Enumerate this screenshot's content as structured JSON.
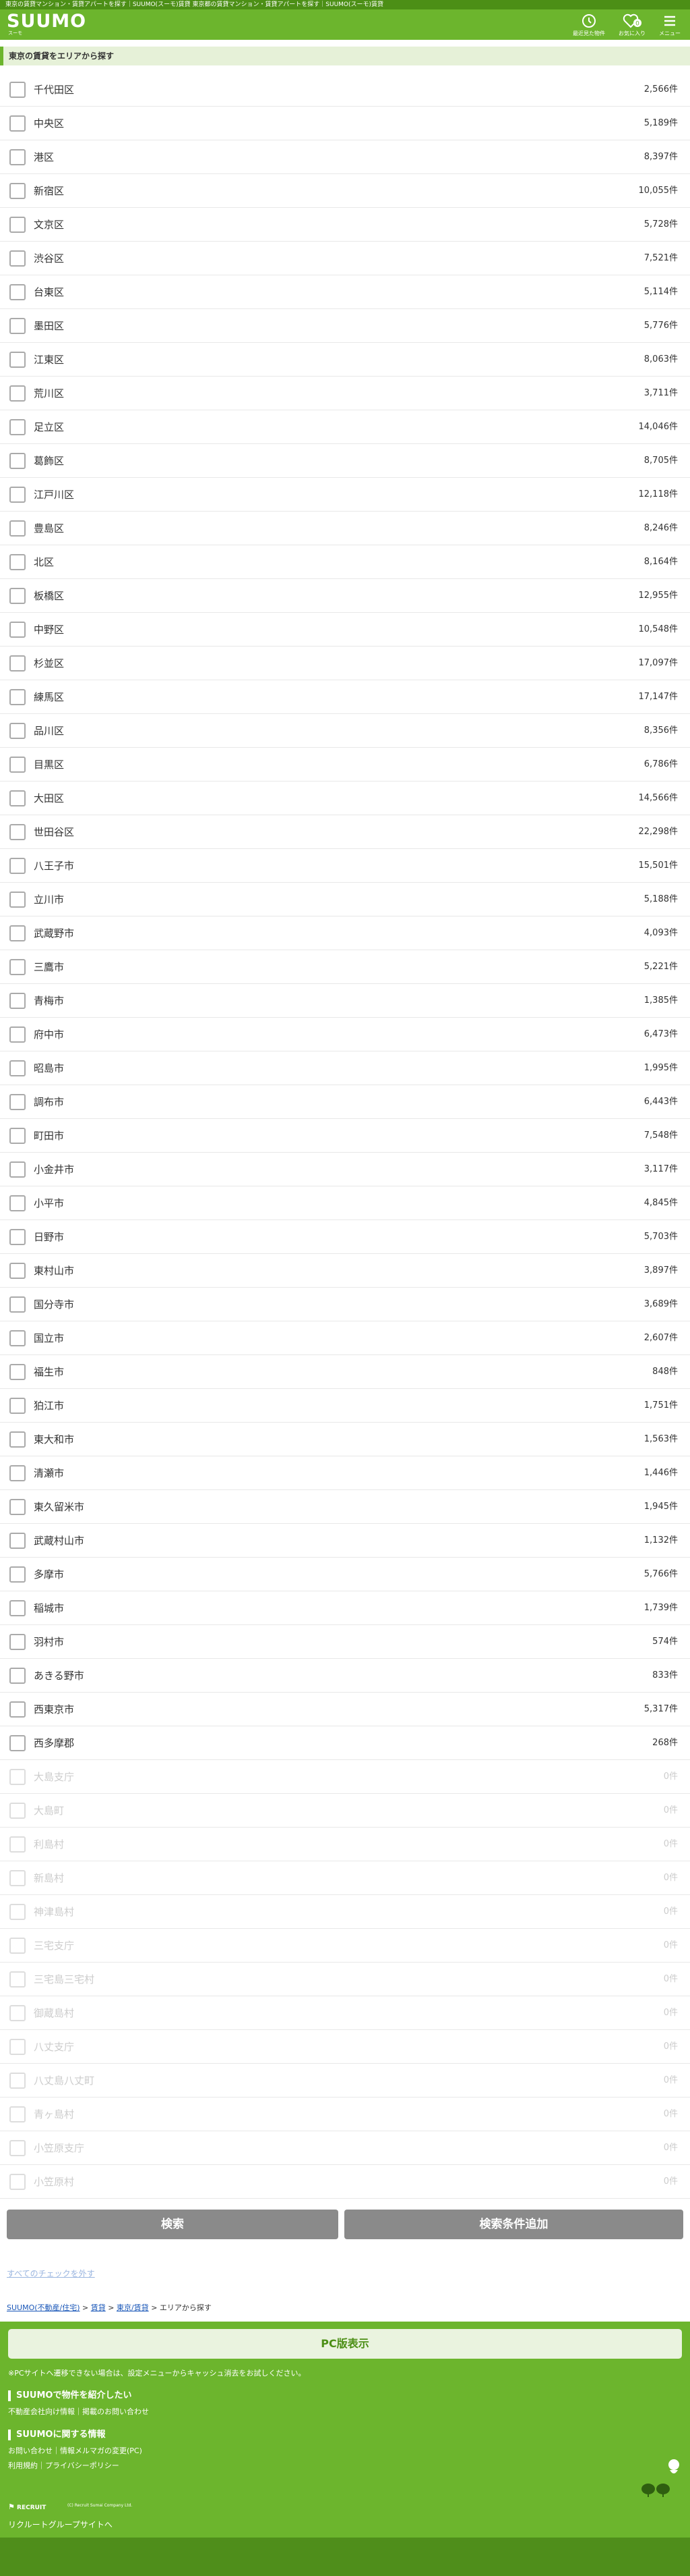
{
  "top_strip": "東京の賃貸マンション・賃貸アパートを探す｜SUUMO(スーモ)賃貸 東京都の賃貸マンション・賃貸アパートを探す｜SUUMO(スーモ)賃貸",
  "header": {
    "logo": "SUUMO",
    "logo_sub": "スーモ",
    "history_label": "最近見た物件",
    "favorites_label": "お気に入り",
    "favorites_count": "0",
    "menu_label": "メニュー"
  },
  "section_title": "東京の賃貸をエリアから探す",
  "areas": [
    {
      "name": "千代田区",
      "count": "2,566件",
      "enabled": true
    },
    {
      "name": "中央区",
      "count": "5,189件",
      "enabled": true
    },
    {
      "name": "港区",
      "count": "8,397件",
      "enabled": true
    },
    {
      "name": "新宿区",
      "count": "10,055件",
      "enabled": true
    },
    {
      "name": "文京区",
      "count": "5,728件",
      "enabled": true
    },
    {
      "name": "渋谷区",
      "count": "7,521件",
      "enabled": true
    },
    {
      "name": "台東区",
      "count": "5,114件",
      "enabled": true
    },
    {
      "name": "墨田区",
      "count": "5,776件",
      "enabled": true
    },
    {
      "name": "江東区",
      "count": "8,063件",
      "enabled": true
    },
    {
      "name": "荒川区",
      "count": "3,711件",
      "enabled": true
    },
    {
      "name": "足立区",
      "count": "14,046件",
      "enabled": true
    },
    {
      "name": "葛飾区",
      "count": "8,705件",
      "enabled": true
    },
    {
      "name": "江戸川区",
      "count": "12,118件",
      "enabled": true
    },
    {
      "name": "豊島区",
      "count": "8,246件",
      "enabled": true
    },
    {
      "name": "北区",
      "count": "8,164件",
      "enabled": true
    },
    {
      "name": "板橋区",
      "count": "12,955件",
      "enabled": true
    },
    {
      "name": "中野区",
      "count": "10,548件",
      "enabled": true
    },
    {
      "name": "杉並区",
      "count": "17,097件",
      "enabled": true
    },
    {
      "name": "練馬区",
      "count": "17,147件",
      "enabled": true
    },
    {
      "name": "品川区",
      "count": "8,356件",
      "enabled": true
    },
    {
      "name": "目黒区",
      "count": "6,786件",
      "enabled": true
    },
    {
      "name": "大田区",
      "count": "14,566件",
      "enabled": true
    },
    {
      "name": "世田谷区",
      "count": "22,298件",
      "enabled": true
    },
    {
      "name": "八王子市",
      "count": "15,501件",
      "enabled": true
    },
    {
      "name": "立川市",
      "count": "5,188件",
      "enabled": true
    },
    {
      "name": "武蔵野市",
      "count": "4,093件",
      "enabled": true
    },
    {
      "name": "三鷹市",
      "count": "5,221件",
      "enabled": true
    },
    {
      "name": "青梅市",
      "count": "1,385件",
      "enabled": true
    },
    {
      "name": "府中市",
      "count": "6,473件",
      "enabled": true
    },
    {
      "name": "昭島市",
      "count": "1,995件",
      "enabled": true
    },
    {
      "name": "調布市",
      "count": "6,443件",
      "enabled": true
    },
    {
      "name": "町田市",
      "count": "7,548件",
      "enabled": true
    },
    {
      "name": "小金井市",
      "count": "3,117件",
      "enabled": true
    },
    {
      "name": "小平市",
      "count": "4,845件",
      "enabled": true
    },
    {
      "name": "日野市",
      "count": "5,703件",
      "enabled": true
    },
    {
      "name": "東村山市",
      "count": "3,897件",
      "enabled": true
    },
    {
      "name": "国分寺市",
      "count": "3,689件",
      "enabled": true
    },
    {
      "name": "国立市",
      "count": "2,607件",
      "enabled": true
    },
    {
      "name": "福生市",
      "count": "848件",
      "enabled": true
    },
    {
      "name": "狛江市",
      "count": "1,751件",
      "enabled": true
    },
    {
      "name": "東大和市",
      "count": "1,563件",
      "enabled": true
    },
    {
      "name": "清瀬市",
      "count": "1,446件",
      "enabled": true
    },
    {
      "name": "東久留米市",
      "count": "1,945件",
      "enabled": true
    },
    {
      "name": "武蔵村山市",
      "count": "1,132件",
      "enabled": true
    },
    {
      "name": "多摩市",
      "count": "5,766件",
      "enabled": true
    },
    {
      "name": "稲城市",
      "count": "1,739件",
      "enabled": true
    },
    {
      "name": "羽村市",
      "count": "574件",
      "enabled": true
    },
    {
      "name": "あきる野市",
      "count": "833件",
      "enabled": true
    },
    {
      "name": "西東京市",
      "count": "5,317件",
      "enabled": true
    },
    {
      "name": "西多摩郡",
      "count": "268件",
      "enabled": true
    },
    {
      "name": "大島支庁",
      "count": "0件",
      "enabled": false
    },
    {
      "name": "大島町",
      "count": "0件",
      "enabled": false
    },
    {
      "name": "利島村",
      "count": "0件",
      "enabled": false
    },
    {
      "name": "新島村",
      "count": "0件",
      "enabled": false
    },
    {
      "name": "神津島村",
      "count": "0件",
      "enabled": false
    },
    {
      "name": "三宅支庁",
      "count": "0件",
      "enabled": false
    },
    {
      "name": "三宅島三宅村",
      "count": "0件",
      "enabled": false
    },
    {
      "name": "御蔵島村",
      "count": "0件",
      "enabled": false
    },
    {
      "name": "八丈支庁",
      "count": "0件",
      "enabled": false
    },
    {
      "name": "八丈島八丈町",
      "count": "0件",
      "enabled": false
    },
    {
      "name": "青ヶ島村",
      "count": "0件",
      "enabled": false
    },
    {
      "name": "小笠原支庁",
      "count": "0件",
      "enabled": false
    },
    {
      "name": "小笠原村",
      "count": "0件",
      "enabled": false
    }
  ],
  "buttons": {
    "search": "検索",
    "add_condition": "検索条件追加"
  },
  "clear_link": "すべてのチェックを外す",
  "breadcrumb": {
    "home": "SUUMO(不動産/住宅)",
    "rent": "賃貸",
    "pref": "東京/賃貸",
    "current": "エリアから探す"
  },
  "footer": {
    "pc_button": "PC版表示",
    "note": "※PCサイトへ遷移できない場合は、設定メニューからキャッシュ消去をお試しください。",
    "section1_title": "SUUMOで物件を紹介したい",
    "section1_link": "不動産会社向け情報｜掲載のお問い合わせ",
    "section2_title": "SUUMOに関する情報",
    "section2_link1": "お問い合わせ｜情報メルマガの変更(PC)",
    "section2_link2": "利用規約｜プライバシーポリシー",
    "recruit": "RECRUIT",
    "copyright": "(C) Recruit Sumai Company Ltd.",
    "group_link": "リクルートグループサイトへ"
  },
  "colors": {
    "brand_green": "#6cb52d",
    "dark_green": "#4c8f16",
    "button_gray": "#8a8a8a"
  }
}
